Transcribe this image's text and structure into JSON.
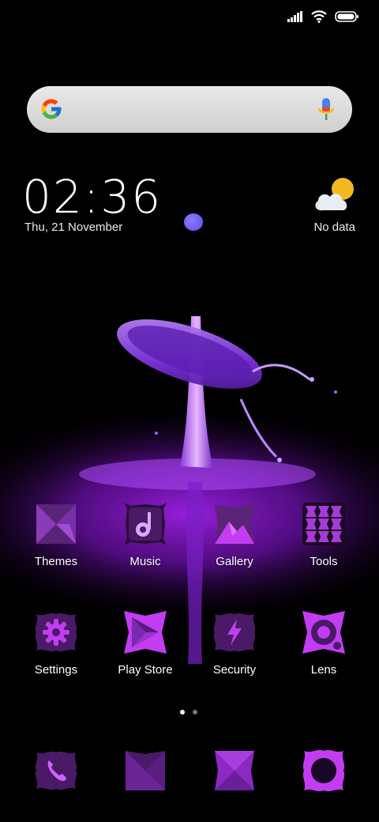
{
  "status_bar": {
    "signal": "signal-bars-icon",
    "wifi": "wifi-icon",
    "battery": "battery-full-icon"
  },
  "search": {
    "left_icon": "google-g-icon",
    "right_icon": "microphone-icon"
  },
  "clock_widget": {
    "time": "02:36",
    "date": "Thu, 21 November"
  },
  "weather_widget": {
    "icon": "partly-cloudy-icon",
    "text": "No data"
  },
  "apps": [
    {
      "label": "Themes",
      "icon": "themes-icon"
    },
    {
      "label": "Music",
      "icon": "music-icon"
    },
    {
      "label": "Gallery",
      "icon": "gallery-icon"
    },
    {
      "label": "Tools",
      "icon": "tools-folder-icon"
    },
    {
      "label": "Settings",
      "icon": "gear-icon"
    },
    {
      "label": "Play Store",
      "icon": "play-store-icon"
    },
    {
      "label": "Security",
      "icon": "lightning-icon"
    },
    {
      "label": "Lens",
      "icon": "lens-icon"
    }
  ],
  "page_indicator": {
    "current": 1,
    "total": 2
  },
  "dock": [
    {
      "icon": "phone-icon"
    },
    {
      "icon": "messaging-icon"
    },
    {
      "icon": "browser-icon"
    },
    {
      "icon": "camera-icon"
    }
  ],
  "colors": {
    "accent": "#c02cf0",
    "icon_dark": "#4a1a66",
    "icon_mid": "#7a2ab0",
    "icon_bright": "#d03cff"
  }
}
